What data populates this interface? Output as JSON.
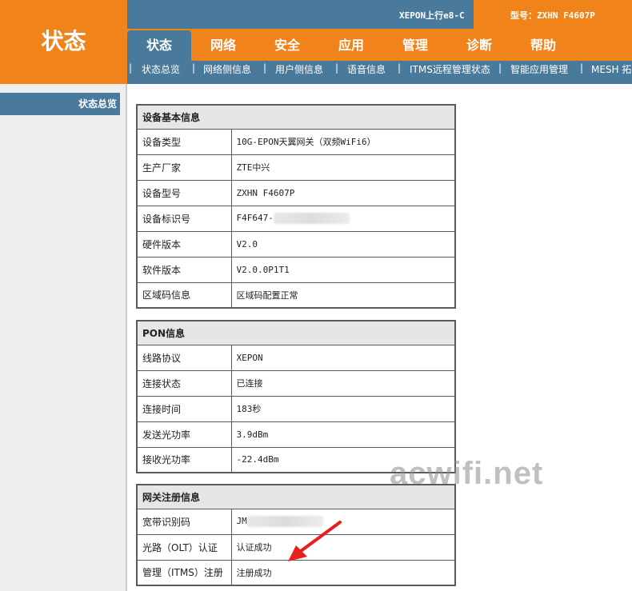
{
  "header": {
    "logo_text": "状态",
    "brand_text": "XEPON上行e8-C",
    "model_text": "型号：ZXHN F4607P"
  },
  "nav": {
    "tabs": [
      {
        "label": "状态",
        "active": true
      },
      {
        "label": "网络",
        "active": false
      },
      {
        "label": "安全",
        "active": false
      },
      {
        "label": "应用",
        "active": false
      },
      {
        "label": "管理",
        "active": false
      },
      {
        "label": "诊断",
        "active": false
      },
      {
        "label": "帮助",
        "active": false
      }
    ]
  },
  "sub_nav": {
    "items": [
      "状态总览",
      "网络侧信息",
      "用户侧信息",
      "语音信息",
      "ITMS远程管理状态",
      "智能应用管理",
      "MESH 拓扑图"
    ]
  },
  "sidebar": {
    "items": [
      {
        "label": "状态总览"
      }
    ]
  },
  "sections": {
    "device": {
      "title": "设备基本信息",
      "rows": [
        {
          "label": "设备类型",
          "value": "10G-EPON天翼网关（双频WiFi6）"
        },
        {
          "label": "生产厂家",
          "value": "ZTE中兴"
        },
        {
          "label": "设备型号",
          "value": "ZXHN  F4607P"
        },
        {
          "label": "设备标识号",
          "value": "F4F647-"
        },
        {
          "label": "硬件版本",
          "value": "V2.0"
        },
        {
          "label": "软件版本",
          "value": "V2.0.0P1T1"
        },
        {
          "label": "区域码信息",
          "value": "区域码配置正常"
        }
      ]
    },
    "pon": {
      "title": "PON信息",
      "rows": [
        {
          "label": "线路协议",
          "value": "XEPON"
        },
        {
          "label": "连接状态",
          "value": "已连接"
        },
        {
          "label": "连接时间",
          "value": "183秒"
        },
        {
          "label": "发送光功率",
          "value": "3.9dBm"
        },
        {
          "label": "接收光功率",
          "value": "-22.4dBm"
        }
      ]
    },
    "gateway": {
      "title": "网关注册信息",
      "rows": [
        {
          "label": "宽带识别码",
          "value": "JM"
        },
        {
          "label": "光路（OLT）认证",
          "value": "认证成功"
        },
        {
          "label": "管理（ITMS）注册",
          "value": "注册成功"
        }
      ]
    }
  },
  "watermark": "acwifi.net",
  "colors": {
    "orange": "#f0841a",
    "steel_blue": "#4a7a9b",
    "arrow_red": "#e8201c"
  }
}
